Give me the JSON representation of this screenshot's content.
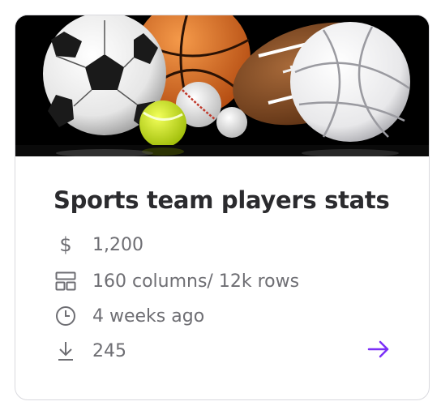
{
  "card": {
    "image": {
      "alt_subject": "sports-balls"
    },
    "title": "Sports team players stats",
    "price": "1,200",
    "size": "160 columns/ 12k rows",
    "updated": "4 weeks ago",
    "downloads": "245",
    "icons": {
      "price": "dollar-icon",
      "size": "layout-grid-icon",
      "updated": "clock-icon",
      "downloads": "download-icon",
      "open": "arrow-right-icon"
    },
    "colors": {
      "accent": "#7b2ff7",
      "title": "#2b2b2e",
      "meta": "#6e6e73",
      "border": "#d9d9de"
    }
  }
}
